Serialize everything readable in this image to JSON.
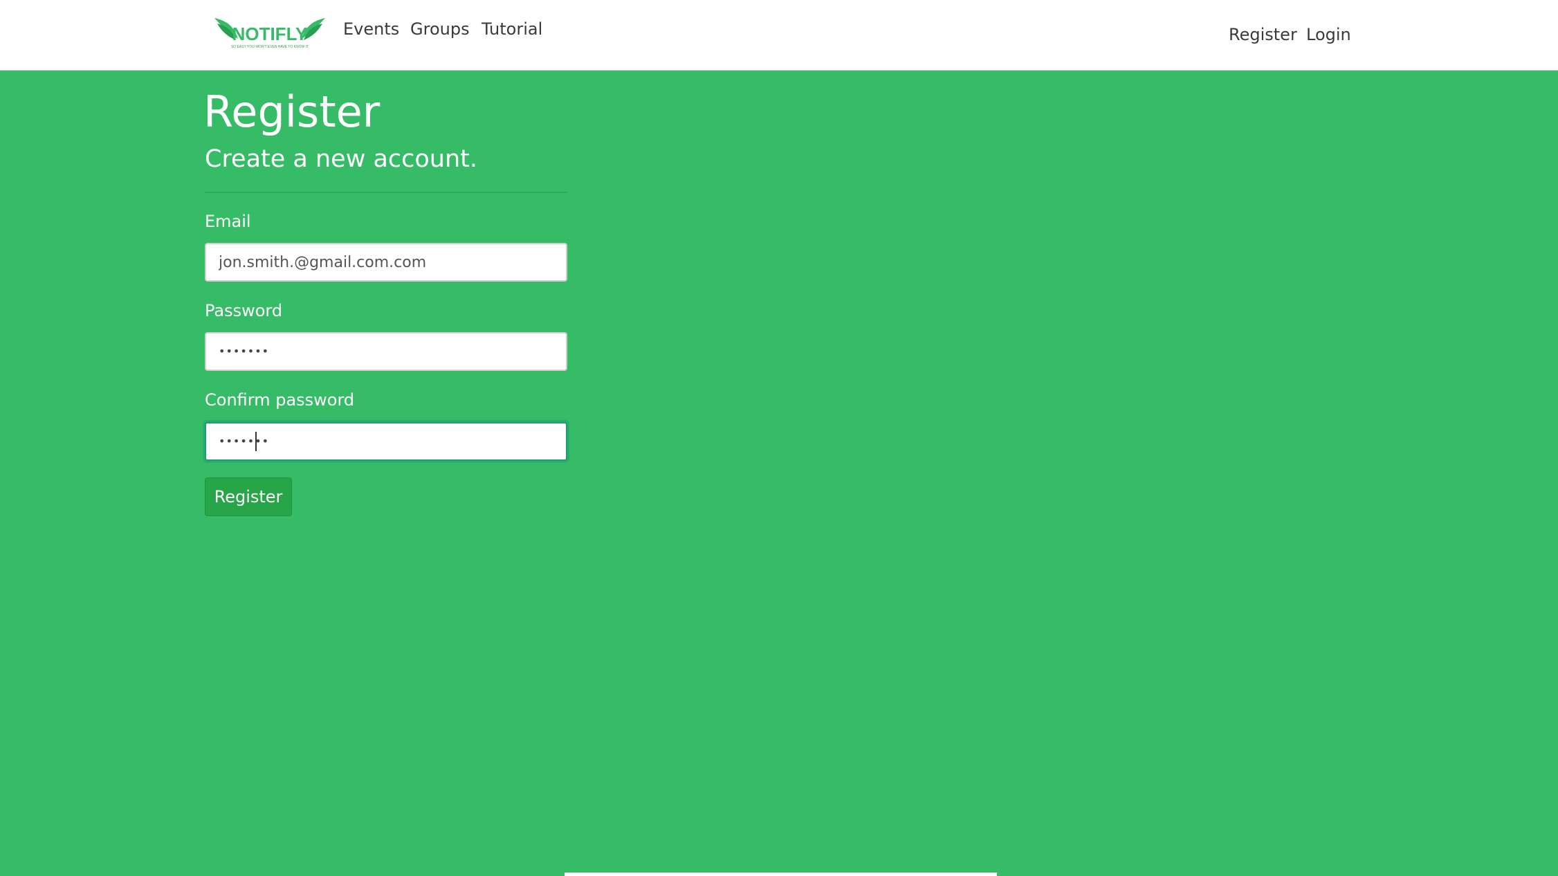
{
  "navbar": {
    "brand": {
      "name": "NOTIFLY",
      "tagline": "SO EASY YOU WON'T EVEN HAVE TO KNOW IT",
      "icon": "wings-logo-icon",
      "color": "#36bb66"
    },
    "links": [
      "Events",
      "Groups",
      "Tutorial"
    ],
    "right_links": [
      "Register",
      "Login"
    ]
  },
  "page": {
    "title": "Register",
    "subtitle": "Create a new account."
  },
  "form": {
    "email": {
      "label": "Email",
      "value": "jon.smith.@gmail.com.com"
    },
    "password": {
      "label": "Password",
      "masked_value": "•••••••"
    },
    "confirm_password": {
      "label": "Confirm password",
      "masked_value": "•••••••"
    },
    "submit_label": "Register"
  },
  "colors": {
    "background": "#36bb66",
    "button": "#27a548",
    "navbar": "#ffffff"
  }
}
